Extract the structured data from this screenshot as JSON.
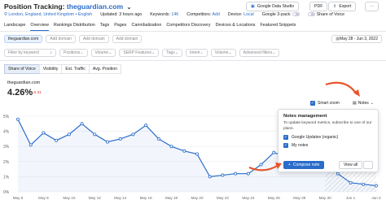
{
  "header": {
    "title_prefix": "Position Tracking:",
    "domain": "theguardian.com",
    "chevron": "⌄",
    "gds_label": "Google Data Studio",
    "pdf_label": "PDF",
    "export_label": "Export",
    "more_label": "⋯"
  },
  "meta": {
    "location": "London, England, United Kingdom • English",
    "updated": "Updated: 3 hours ago",
    "keywords_label": "Keywords:",
    "keywords_value": "146",
    "competitors_label": "Competitors:",
    "competitors_value": "Add",
    "device_label": "Device:",
    "device_value": "Local",
    "gpack_label": "Google 3-pack:",
    "share_label": "Share of Voice"
  },
  "tabs": [
    "Landscape",
    "Overview",
    "Rankings Distribution",
    "Tags",
    "Pages",
    "Cannibalization",
    "Competitors Discovery",
    "Devices & Locations",
    "Featured Snippets"
  ],
  "active_tab": "Overview",
  "filters": {
    "domain_pill": "theguardian.com",
    "add_domain_1": "Add domain",
    "add_domain_2": "Add domain",
    "add_domain_3": "Add domain",
    "date_range": "May 28 - Jun 3, 2022",
    "search_placeholder": "Filter by keyword",
    "positions": "Positions",
    "volume": "Volume",
    "serp": "SERP Features",
    "tags": "Tags",
    "intent": "Intent",
    "volume2": "Volume",
    "advanced": "Advanced filters"
  },
  "view_tabs": [
    "Share of Voice",
    "Visibility",
    "Est. Traffic",
    "Avg. Position"
  ],
  "active_view": "Share of Voice",
  "summary": {
    "domain": "theguardian.com",
    "value": "4.26%",
    "delta": "-0.31"
  },
  "controls": {
    "smart_zoom": "Smart zoom",
    "notes": "Notes"
  },
  "chart_data": {
    "type": "line",
    "x": [
      "May 6",
      "May 7",
      "May 8",
      "May 9",
      "May 10",
      "May 11",
      "May 12",
      "May 13",
      "May 14",
      "May 15",
      "May 16",
      "May 17",
      "May 18",
      "May 19",
      "May 20",
      "May 21",
      "May 22",
      "May 23",
      "May 24",
      "May 25",
      "May 26",
      "May 27",
      "May 28",
      "May 29",
      "May 30",
      "May 31",
      "Jun 1",
      "Jun 2",
      "Jun 3"
    ],
    "values": [
      4.8,
      3.1,
      3.9,
      3.4,
      3.8,
      4.5,
      3.8,
      3.3,
      3.5,
      3.8,
      4.4,
      3.5,
      3.0,
      2.7,
      2.5,
      1.0,
      1.1,
      1.2,
      1.2,
      1.8,
      2.6,
      2.3,
      3.1,
      2.6,
      2.1,
      1.2,
      0.6,
      0.5,
      0.4
    ],
    "yticks": [
      "5%",
      "4%",
      "3%",
      "2%",
      "1%",
      "0%"
    ],
    "xtick_labels": [
      "May 6",
      "May 8",
      "May 10",
      "May 12",
      "May 14",
      "May 16",
      "May 18",
      "May 20",
      "May 22",
      "May 24",
      "May 26",
      "May 28",
      "May 30",
      "Jun 1",
      "Jun 3"
    ],
    "ylim": [
      0,
      5
    ],
    "color": "#2a6cc9"
  },
  "popup": {
    "title": "Notes management",
    "desc": "To update keyword metrics, subscribe to one of our plans.",
    "cb1": "Google Updates (organic)",
    "cb2": "My notes",
    "compose": "Compose note",
    "view_all": "View all"
  },
  "colors": {
    "accent": "#2a6cc9",
    "arrow": "#e8542a"
  }
}
